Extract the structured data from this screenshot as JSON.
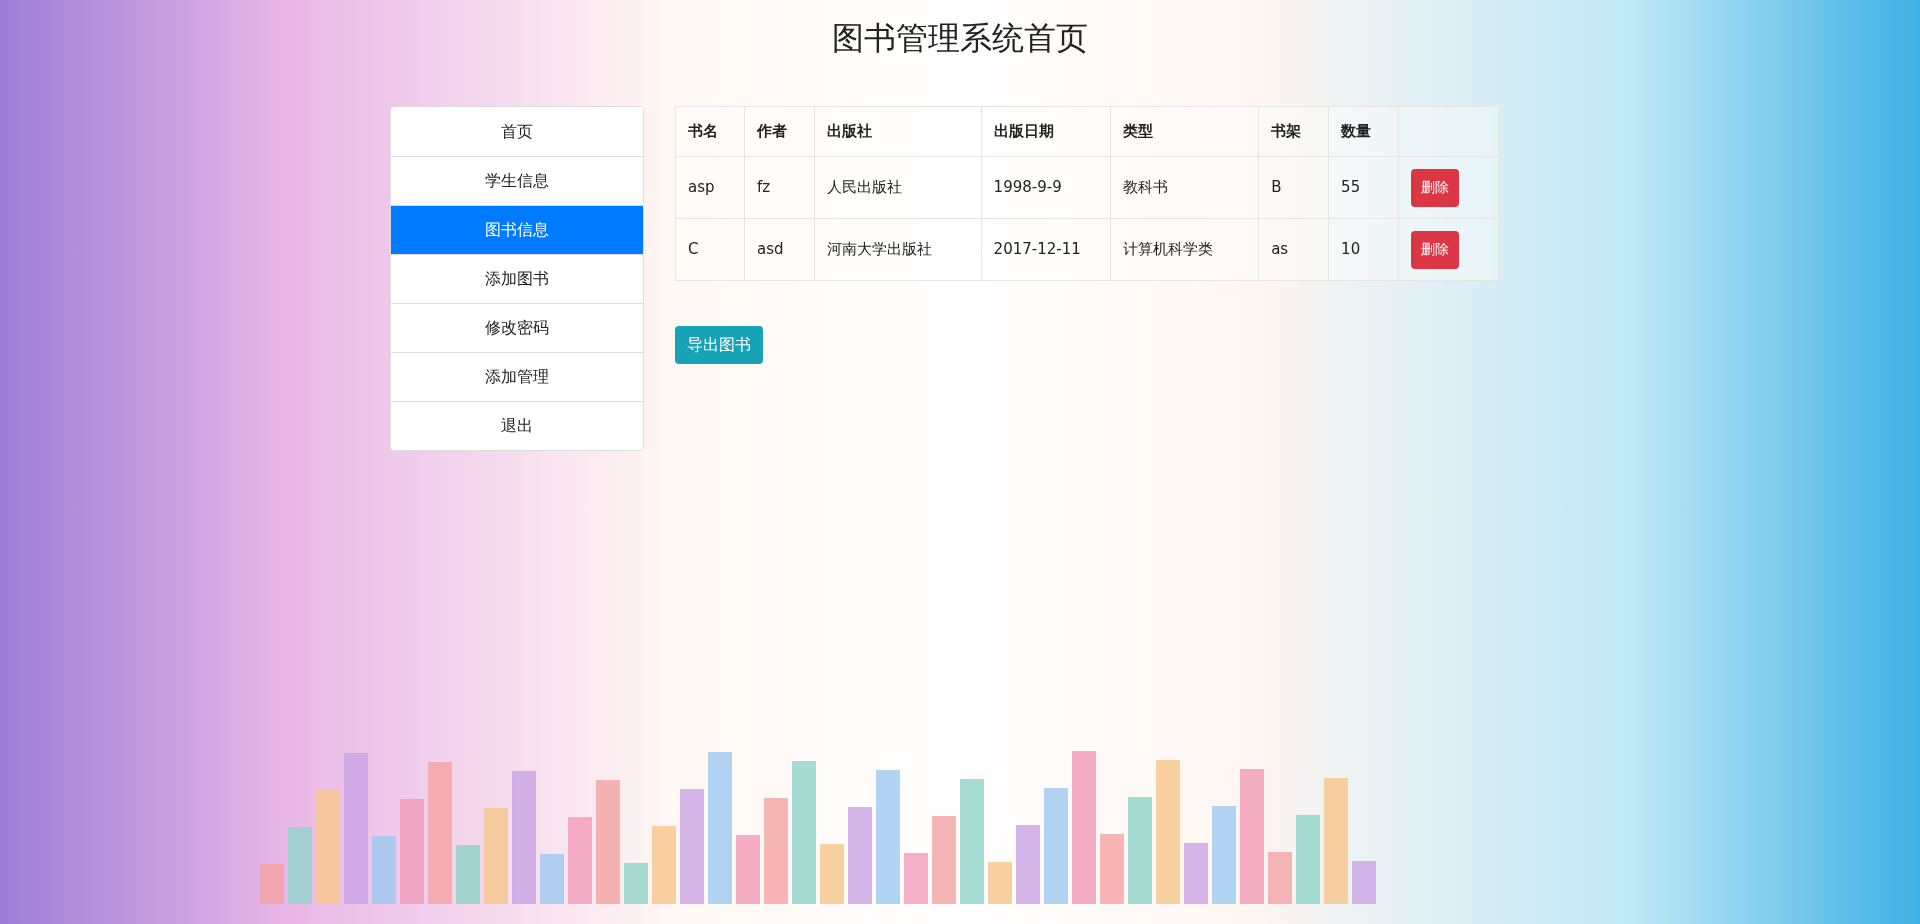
{
  "title": "图书管理系统首页",
  "sidebar": {
    "items": [
      {
        "label": "首页",
        "selected": false
      },
      {
        "label": "学生信息",
        "selected": false
      },
      {
        "label": "图书信息",
        "selected": true
      },
      {
        "label": "添加图书",
        "selected": false
      },
      {
        "label": "修改密码",
        "selected": false
      },
      {
        "label": "添加管理",
        "selected": false
      },
      {
        "label": "退出",
        "selected": false
      }
    ]
  },
  "table": {
    "columns": [
      "书名",
      "作者",
      "出版社",
      "出版日期",
      "类型",
      "书架",
      "数量"
    ],
    "rows": [
      {
        "cells": [
          "asp",
          "fz",
          "人民出版社",
          "1998-9-9",
          "教科书",
          "B",
          "55"
        ],
        "action": "删除"
      },
      {
        "cells": [
          "C",
          "asd",
          "河南大学出版社",
          "2017-12-11",
          "计算机科学类",
          "as",
          "10"
        ],
        "action": "删除"
      }
    ]
  },
  "export_button": "导出图书"
}
